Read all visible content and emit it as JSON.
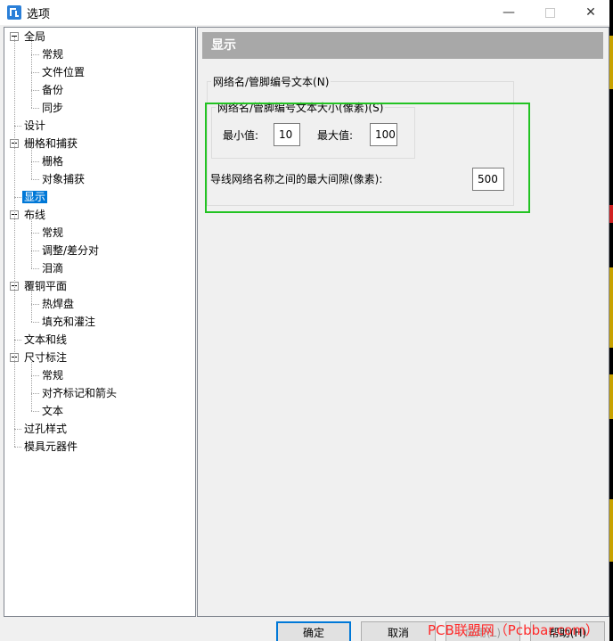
{
  "window": {
    "title": "选项"
  },
  "tree": [
    {
      "id": "global",
      "label": "全局",
      "level": 0,
      "expandable": true
    },
    {
      "id": "general",
      "label": "常规",
      "level": 1
    },
    {
      "id": "file-locations",
      "label": "文件位置",
      "level": 1
    },
    {
      "id": "backup",
      "label": "备份",
      "level": 1
    },
    {
      "id": "sync",
      "label": "同步",
      "level": 1
    },
    {
      "id": "design",
      "label": "设计",
      "level": 0
    },
    {
      "id": "grid-snap",
      "label": "栅格和捕获",
      "level": 0,
      "expandable": true
    },
    {
      "id": "grid",
      "label": "栅格",
      "level": 1
    },
    {
      "id": "object-snap",
      "label": "对象捕获",
      "level": 1
    },
    {
      "id": "display",
      "label": "显示",
      "level": 0,
      "selected": true
    },
    {
      "id": "routing",
      "label": "布线",
      "level": 0,
      "expandable": true
    },
    {
      "id": "routing-general",
      "label": "常规",
      "level": 1
    },
    {
      "id": "tuning-diffpair",
      "label": "调整/差分对",
      "level": 1
    },
    {
      "id": "teardrops",
      "label": "泪滴",
      "level": 1
    },
    {
      "id": "copper-pour",
      "label": "覆铜平面",
      "level": 0,
      "expandable": true
    },
    {
      "id": "thermal-pads",
      "label": "热焊盘",
      "level": 1
    },
    {
      "id": "fill-flood",
      "label": "填充和灌注",
      "level": 1
    },
    {
      "id": "text-lines",
      "label": "文本和线",
      "level": 0
    },
    {
      "id": "dimensioning",
      "label": "尺寸标注",
      "level": 0,
      "expandable": true
    },
    {
      "id": "dim-general",
      "label": "常规",
      "level": 1
    },
    {
      "id": "alignment-arrows",
      "label": "对齐标记和箭头",
      "level": 1
    },
    {
      "id": "dim-text",
      "label": "文本",
      "level": 1
    },
    {
      "id": "via-styles",
      "label": "过孔样式",
      "level": 0
    },
    {
      "id": "die-components",
      "label": "模具元器件",
      "level": 0
    }
  ],
  "panel": {
    "header": "显示",
    "group_net_pin": {
      "legend": "网络名/管脚编号文本(N)",
      "sub_legend": "网络名/管脚编号文本大小(像素)(S)",
      "min_label": "最小值:",
      "min_value": "10",
      "max_label": "最大值:",
      "max_value": "100",
      "spacing_label": "导线网络名称之间的最大间隙(像素):",
      "spacing_value": "500"
    }
  },
  "buttons": {
    "ok": "确定",
    "cancel": "取消",
    "apply": "应用(L)",
    "help": "帮助(H)"
  },
  "watermark": "PCB联盟网（Pcbbar.com）",
  "colors": {
    "selection": "#0078d7",
    "header_bg": "#a8a8a8",
    "highlight_border": "#22c322",
    "watermark": "#ff2a2a"
  }
}
